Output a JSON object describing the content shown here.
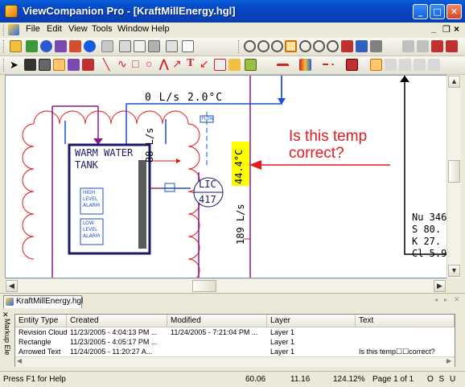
{
  "window": {
    "title": "ViewCompanion Pro - [KraftMillEnergy.hgl]"
  },
  "menu": [
    {
      "label": "File",
      "key": "F"
    },
    {
      "label": "Edit",
      "key": "E"
    },
    {
      "label": "View",
      "key": "V"
    },
    {
      "label": "Tools",
      "key": "T"
    },
    {
      "label": "Window",
      "key": "W"
    },
    {
      "label": "Help",
      "key": "H"
    }
  ],
  "menu_right": {
    "minimize": "_",
    "restore": "❐",
    "close": "×"
  },
  "drawing": {
    "flow_top": "0 L/s 2.0°C",
    "flow_label": "FLOW",
    "tank_title_1": "WARM WATER",
    "tank_title_2": "TANK",
    "high_1": "HIGH",
    "high_2": "LEVEL",
    "high_3": "ALARM",
    "low_1": "LOW",
    "low_2": "LEVEL",
    "low_3": "ALARM",
    "vert_88": "88 L/s",
    "vert_44": "44.4°C",
    "vert_189": "189 L/s",
    "lic_1": "LIC",
    "lic_2": "417",
    "annotation_1": "Is this temp",
    "annotation_2": "correct?",
    "right_1": "Nu 346",
    "right_2": "S  80.",
    "right_3": "K  27.",
    "right_4": "Cl 5.9",
    "colors": {
      "annotation": "#e8191c",
      "highlight": "#ffff00",
      "pipe_blue": "#1a4fd6",
      "cloud_red": "#e8191c",
      "purple": "#8a1a8a"
    }
  },
  "tab": {
    "label": "KraftMillEnergy.hgl"
  },
  "panel": {
    "side_label": "Markup Ele",
    "columns": [
      "Entity Type",
      "Created",
      "Modified",
      "Layer",
      "Text"
    ],
    "rows": [
      [
        "Revision Cloud",
        "11/23/2005 - 4:04:13 PM ...",
        "11/24/2005 - 7:21:04 PM ...",
        "Layer 1",
        ""
      ],
      [
        "Rectangle",
        "11/23/2005 - 4:05:17 PM ...",
        "",
        "Layer 1",
        ""
      ],
      [
        "Arrowed Text",
        "11/24/2005 - 11:20:27 A...",
        "",
        "Layer 1",
        "Is this temp☐☐correct?"
      ]
    ]
  },
  "status": {
    "help": "Press F1 for Help",
    "x": "60.06",
    "y": "11.16",
    "zoom": "124.12%",
    "page": "Page 1 of 1",
    "flags": "O S U"
  }
}
